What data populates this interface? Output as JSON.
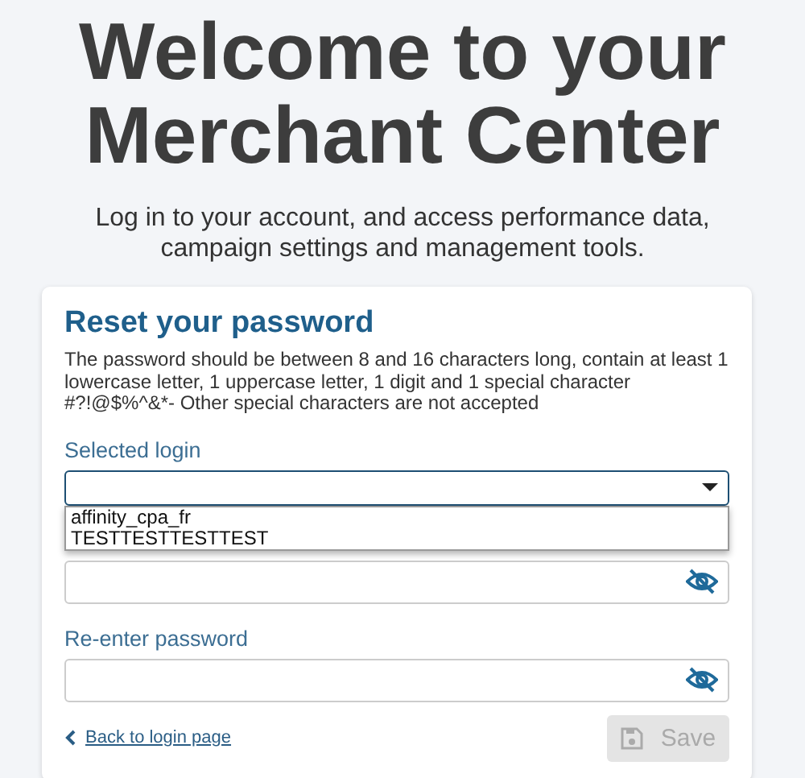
{
  "header": {
    "title_lines": [
      "Welcome to your",
      "Merchant Center"
    ],
    "subtitle": "Log in to your account, and access performance data, campaign settings and management tools."
  },
  "card": {
    "title": "Reset your password",
    "hint": "The password should be between 8 and 16 characters long, contain at least 1 lowercase letter, 1 uppercase letter, 1 digit and 1 special character #?!@$%^&*- Other special characters are not accepted",
    "fields": [
      {
        "kind": "select",
        "label": "Selected login",
        "expanded": true,
        "options": [
          {
            "label": "affinity_cpa_fr",
            "selected": false
          },
          {
            "label": "TESTTESTTESTTEST",
            "selected": false
          }
        ]
      },
      {
        "kind": "password"
      },
      {
        "kind": "password",
        "label": "Re-enter password"
      }
    ],
    "back_link": "Back to login page",
    "save_button": {
      "label": "Save",
      "disabled": true
    }
  }
}
